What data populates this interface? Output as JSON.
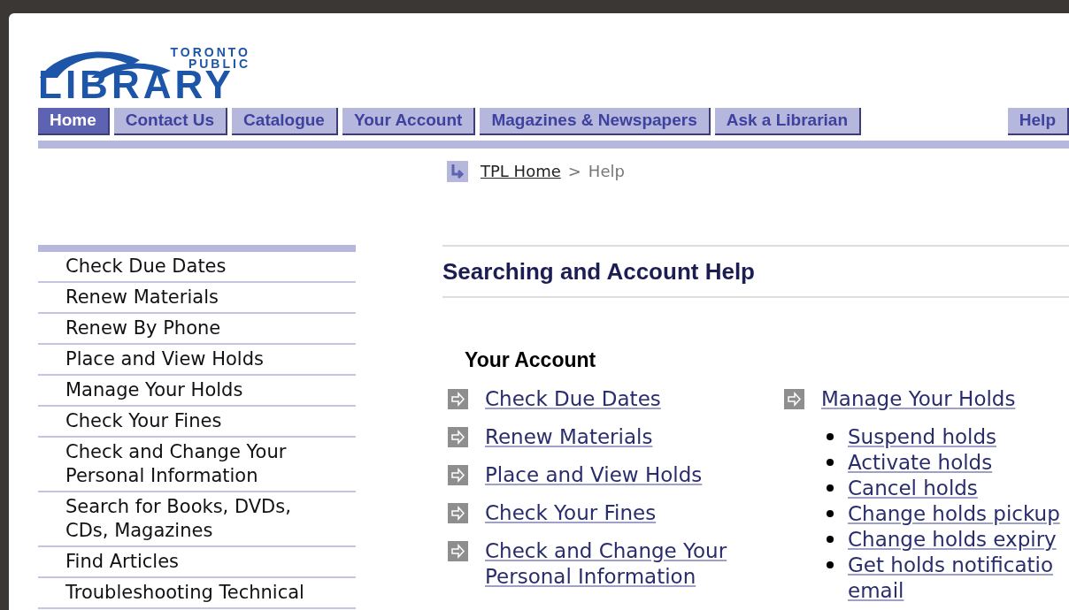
{
  "logo": {
    "top_line": "TORONTO",
    "middle_line": "PUBLIC",
    "main_word": "LIBRARY"
  },
  "nav_tabs": [
    {
      "label": "Home",
      "selected": true
    },
    {
      "label": "Contact Us",
      "selected": false
    },
    {
      "label": "Catalogue",
      "selected": false
    },
    {
      "label": "Your Account",
      "selected": false
    },
    {
      "label": "Magazines & Newspapers",
      "selected": false
    },
    {
      "label": "Ask a Librarian",
      "selected": false
    },
    {
      "label": "Help",
      "selected": false
    }
  ],
  "breadcrumb": {
    "link": "TPL Home",
    "separator": ">",
    "current": "Help"
  },
  "sidebar": {
    "items": [
      "Check Due Dates",
      "Renew Materials",
      "Renew By Phone",
      "Place and View Holds",
      "Manage Your Holds",
      "Check Your Fines",
      "Check and Change Your Personal Information",
      "Search for Books, DVDs, CDs, Magazines",
      "Find Articles",
      "Troubleshooting Technical"
    ]
  },
  "main": {
    "title": "Searching and Account Help",
    "section": "Your Account",
    "left_links": [
      "Check Due Dates",
      "Renew Materials",
      "Place and View Holds",
      "Check Your Fines",
      "Check and Change Your Personal Information"
    ],
    "right_link": "Manage Your Holds",
    "right_sublinks": [
      "Suspend holds",
      "Activate holds",
      "Cancel holds",
      "Change holds pickup",
      "Change holds expiry",
      "Get holds notificatio"
    ],
    "right_sublink_continuation": "email"
  }
}
